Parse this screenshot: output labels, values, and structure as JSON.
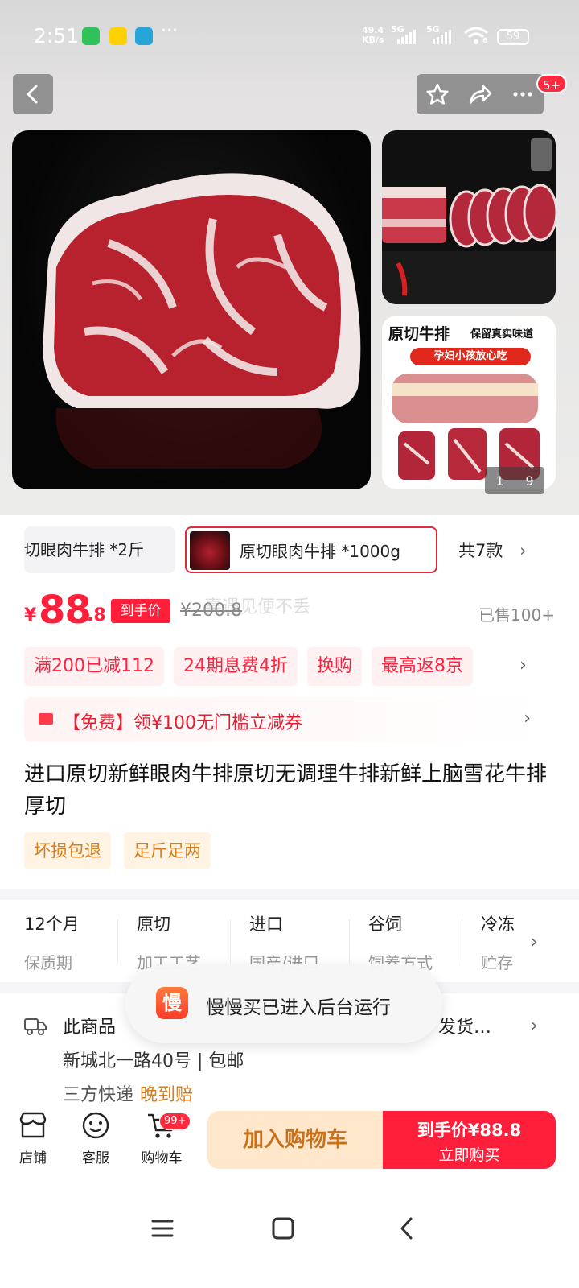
{
  "status_bar": {
    "time": "2:51",
    "net_speed_value": "49.4",
    "net_speed_unit": "KB/s",
    "sim1": "5G",
    "sim2": "5G",
    "wifi_sub": "6",
    "battery": "59",
    "more": "···"
  },
  "header": {
    "badge": "5+"
  },
  "gallery": {
    "side_title": "原切牛排",
    "side_subtitle": "保留真实味道",
    "side_pill": "孕妇小孩放心吃",
    "pager_current": "1",
    "pager_total": "9"
  },
  "variants": {
    "items": [
      "切眼肉牛排 *2斤",
      "原切眼肉牛排 *1000g"
    ],
    "selected_index": 1,
    "total_label": "共7款"
  },
  "price": {
    "currency": "¥",
    "integer": "88",
    "decimal": ".8",
    "tag": "到手价",
    "original": "¥200.8",
    "watermark": "喜遇见便不丢",
    "sold": "已售100+"
  },
  "promos": [
    "满200已减112",
    "24期息费4折",
    "换购",
    "最高返8京"
  ],
  "coupon": {
    "text": "【免费】领¥100无门槛立减券"
  },
  "product": {
    "title": "进口原切新鲜眼肉牛排原切无调理牛排新鲜上脑雪花牛排厚切",
    "tags": [
      "坏损包退",
      "足斤足两"
    ]
  },
  "attributes": [
    {
      "value": "12个月",
      "key": "保质期"
    },
    {
      "value": "原切",
      "key": "加工工艺"
    },
    {
      "value": "进口",
      "key": "国产/进口"
    },
    {
      "value": "谷饲",
      "key": "饲养方式"
    },
    {
      "value": "冷冻",
      "key": "贮存"
    }
  ],
  "shipping": {
    "line1_start": "此商品",
    "line1_end": "发货…",
    "line2": "新城北一路40号 | 包邮",
    "line3_prefix": "三方快递",
    "line3_late": "晚到赔"
  },
  "toast": {
    "icon_char": "慢",
    "text": "慢慢买已进入后台运行"
  },
  "bottom_bar": {
    "store": "店铺",
    "service": "客服",
    "cart": "购物车",
    "cart_badge": "99+",
    "add_cart": "加入购物车",
    "buy_line1": "到手价¥88.8",
    "buy_line2": "立即购买"
  },
  "colors": {
    "accent": "#ff1f3a",
    "cart_button_bg": "#ffe7cc",
    "tag_orange": "#d77d1c"
  }
}
